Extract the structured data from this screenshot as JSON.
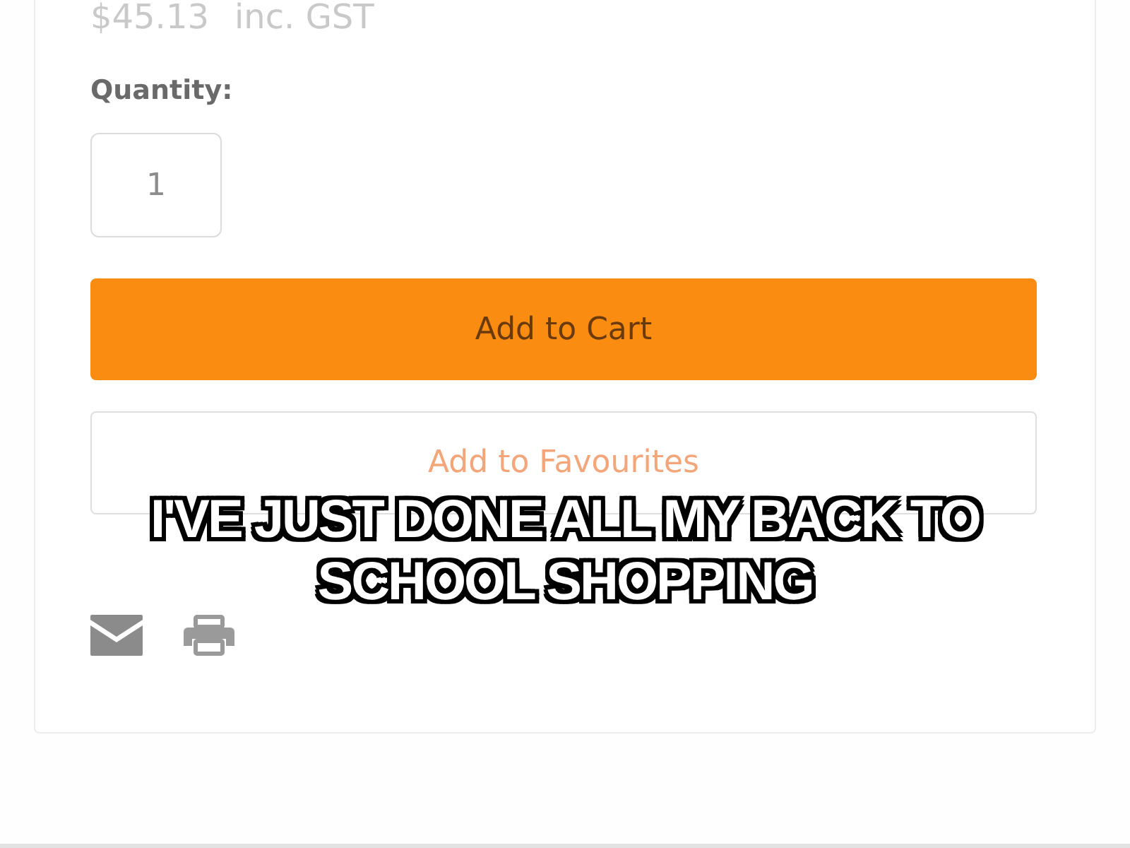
{
  "product": {
    "price": "$45.13",
    "tax_note": "inc. GST",
    "quantity": {
      "label": "Quantity:",
      "value": "1"
    },
    "buttons": [
      {
        "label": "Add to Cart",
        "kind": "primary"
      },
      {
        "label": "Add to Favourites",
        "kind": "outline"
      }
    ]
  },
  "caption": "I'VE JUST DONE ALL MY BACK TO SCHOOL SHOPPING"
}
